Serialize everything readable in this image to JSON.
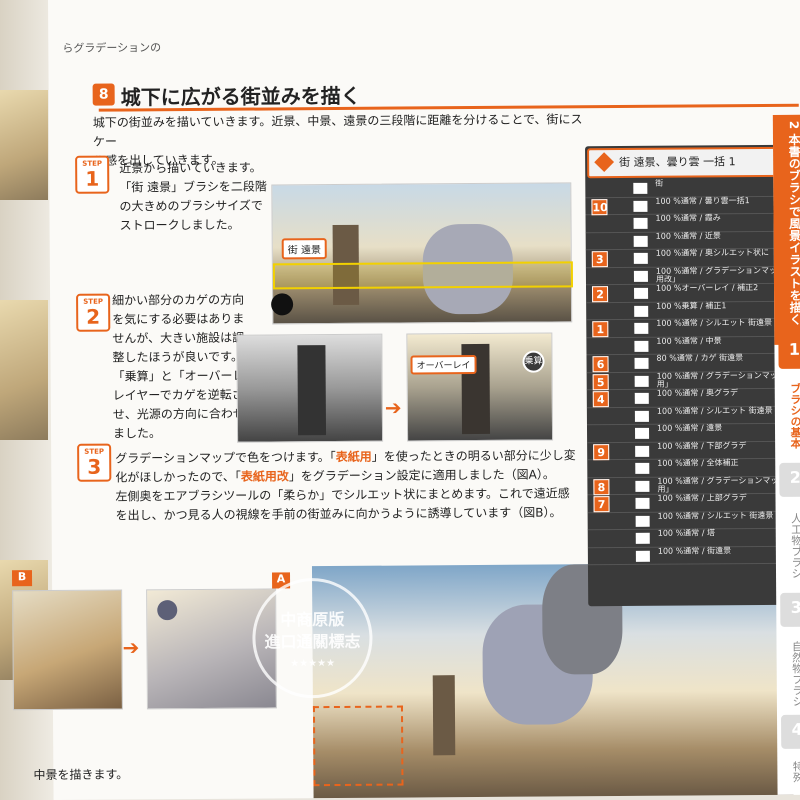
{
  "left_page": {
    "snippet": "らグラデーションの"
  },
  "section": {
    "number": "8",
    "title": "城下に広がる街並みを描く"
  },
  "intro": {
    "line1": "城下の街並みを描いていきます。近景、中景、遠景の三段階に距離を分けることで、街にスケー",
    "line2": "ル感を出していきます。"
  },
  "step1": {
    "label": "STEP",
    "num": "1",
    "lines": [
      "近景から描いていきます。",
      "「街 遠景」ブラシを二段階",
      "の大きめのブラシサイズで",
      "ストロークしました。"
    ],
    "badge": "街 遠景"
  },
  "step2": {
    "label": "STEP",
    "num": "2",
    "lines": [
      "細かい部分のカゲの方向",
      "を気にする必要はありま",
      "せんが、大きい施設は調",
      "整したほうが良いです。",
      "「乗算」と「オーバーレイ」",
      "レイヤーでカゲを逆転さ",
      "せ、光源の方向に合わせ",
      "ました。"
    ],
    "overlay_badge": "オーバーレイ",
    "multiply_badge": "乗算"
  },
  "step3": {
    "label": "STEP",
    "num": "3",
    "l1": "グラデーションマップで色をつけます。「",
    "h1": "表紙用",
    "l1b": "」を使ったときの明るい部分に少し変",
    "l2": "化がほしかったので、「",
    "h2": "表紙用改",
    "l2b": "」をグラデーション設定に適用しました（図A）。",
    "l3": "左側奥をエアブラシツールの「柔らか」でシルエット状にまとめます。これで遠近感",
    "l4": "を出し、かつ見る人の視線を手前の街並みに向かうように誘導しています（図B）。"
  },
  "fig_a": "A",
  "fig_b": "B",
  "bottom": {
    "text": "中景を描きます。"
  },
  "stamp": {
    "line1": "中商原版",
    "line2": "進口通關標志",
    "stars": "★★★★★"
  },
  "layers": {
    "header": "街 遠景、曇り雲 一括 1",
    "rows": [
      {
        "tag": "",
        "text": "街"
      },
      {
        "tag": "10",
        "text": "100 %通常 / 曇り雲一括1"
      },
      {
        "tag": "",
        "text": "100 %通常 / 霞み"
      },
      {
        "tag": "",
        "text": "100 %通常 / 近景"
      },
      {
        "tag": "3",
        "text": "100 %通常 / 奥シルエット状に"
      },
      {
        "tag": "",
        "text": "100 %通常 / グラデーションマップ「表紙用改」"
      },
      {
        "tag": "2",
        "text": "100 %オーバーレイ / 補正2"
      },
      {
        "tag": "",
        "text": "100 %乗算 / 補正1"
      },
      {
        "tag": "1",
        "text": "100 %通常 / シルエット 街遠景"
      },
      {
        "tag": "",
        "text": "100 %通常 / 中景"
      },
      {
        "tag": "6",
        "text": "80 %通常 / カゲ 街遠景"
      },
      {
        "tag": "5",
        "text": "100 %通常 / グラデーションマップ「表紙用」"
      },
      {
        "tag": "4",
        "text": "100 %通常 / 奥グラデ"
      },
      {
        "tag": "",
        "text": "100 %通常 / シルエット 街遠景"
      },
      {
        "tag": "",
        "text": "100 %通常 / 遠景"
      },
      {
        "tag": "9",
        "text": "100 %通常 / 下部グラデ"
      },
      {
        "tag": "",
        "text": "100 %通常 / 全体補正"
      },
      {
        "tag": "8",
        "text": "100 %通常 / グラデーションマップ「表紙用」"
      },
      {
        "tag": "7",
        "text": "100 %通常 / 上部グラデ"
      },
      {
        "tag": "",
        "text": "100 %通常 / シルエット 街遠景"
      },
      {
        "tag": "",
        "text": "100 %通常 / 塔"
      },
      {
        "tag": "",
        "text": "100 %通常 / 街遠景"
      }
    ]
  },
  "sidebar": {
    "page_num": "2",
    "top_title": "本書のブラシで風景イラストを描く",
    "ch1": "1",
    "tab1": "ブラシの基本",
    "ch2": "2",
    "tab2": "人工物ブラシ",
    "ch3": "3",
    "tab3": "自然物ブラシ",
    "ch4": "4",
    "tab4": "特殊"
  }
}
